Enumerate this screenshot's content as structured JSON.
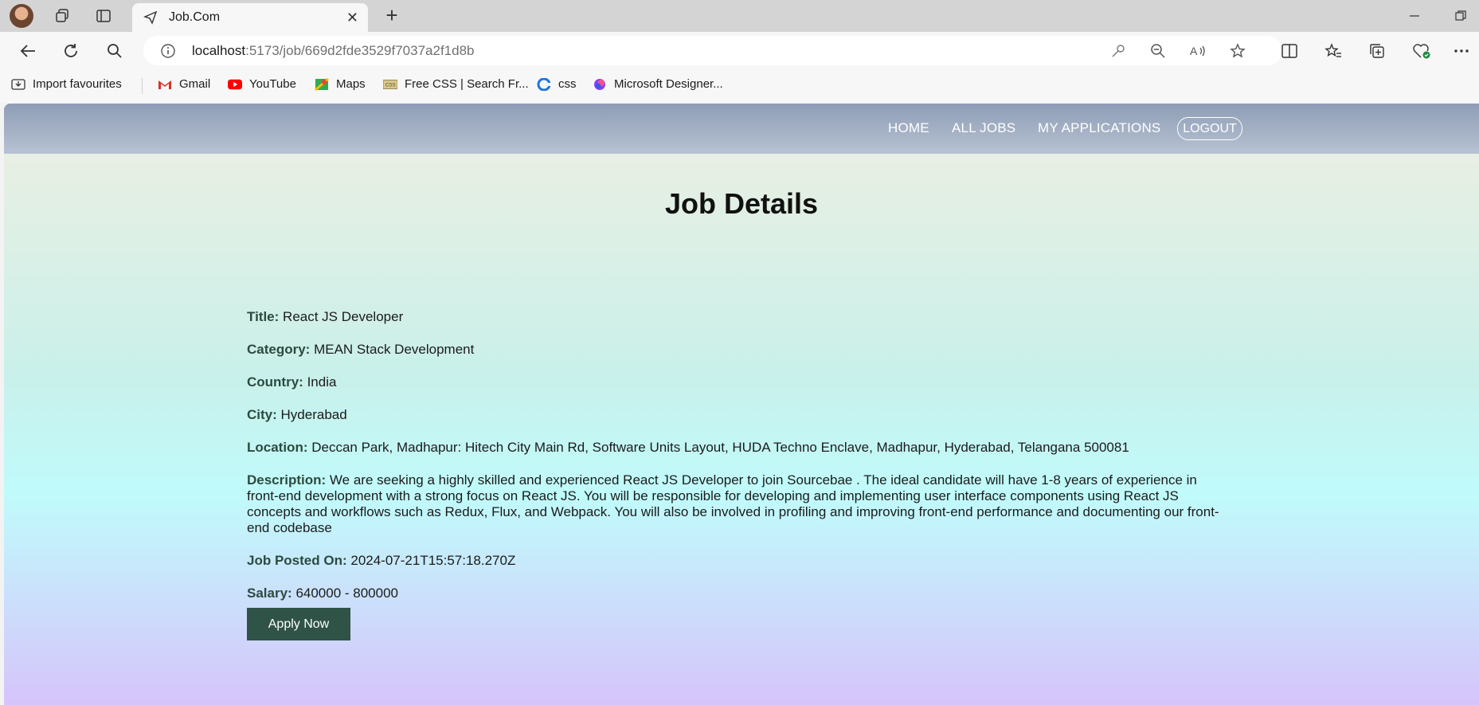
{
  "browser": {
    "tab": {
      "title": "Job.Com",
      "close_glyph": "✕"
    },
    "new_tab_glyph": "+",
    "url": {
      "host": "localhost",
      "path": ":5173/job/669d2fde3529f7037a2f1d8b"
    },
    "bookmarks": [
      {
        "label": "Import favourites",
        "icon": "import-icon"
      },
      {
        "label": "Gmail",
        "icon": "gmail-icon"
      },
      {
        "label": "YouTube",
        "icon": "youtube-icon"
      },
      {
        "label": "Maps",
        "icon": "maps-icon"
      },
      {
        "label": "Free CSS | Search Fr...",
        "icon": "freecss-icon"
      },
      {
        "label": "css",
        "icon": "css-icon"
      },
      {
        "label": "Microsoft Designer...",
        "icon": "designer-icon"
      }
    ]
  },
  "nav": {
    "links": [
      "HOME",
      "ALL JOBS",
      "MY APPLICATIONS"
    ],
    "logout": "LOGOUT"
  },
  "page": {
    "heading": "Job Details",
    "fields": [
      {
        "label": "Title:",
        "value": "React JS Developer"
      },
      {
        "label": "Category:",
        "value": "MEAN Stack Development"
      },
      {
        "label": "Country:",
        "value": "India"
      },
      {
        "label": "City:",
        "value": "Hyderabad"
      },
      {
        "label": "Location:",
        "value": "Deccan Park, Madhapur: Hitech City Main Rd, Software Units Layout, HUDA Techno Enclave, Madhapur, Hyderabad, Telangana 500081"
      },
      {
        "label": "Description:",
        "value": "We are seeking a highly skilled and experienced React JS Developer to join Sourcebae . The ideal candidate will have 1-8 years of experience in front-end development with a strong focus on React JS. You will be responsible for developing and implementing user interface components using React JS concepts and workflows such as Redux, Flux, and Webpack. You will also be involved in profiling and improving front-end performance and documenting our front-end codebase"
      },
      {
        "label": "Job Posted On:",
        "value": "2024-07-21T15:57:18.270Z"
      },
      {
        "label": "Salary:",
        "value": "640000 - 800000"
      }
    ],
    "apply_label": "Apply Now"
  },
  "colors": {
    "navbar": "#8e9db6",
    "apply_button": "#2f5347",
    "label_text": "#2d4a3e"
  }
}
